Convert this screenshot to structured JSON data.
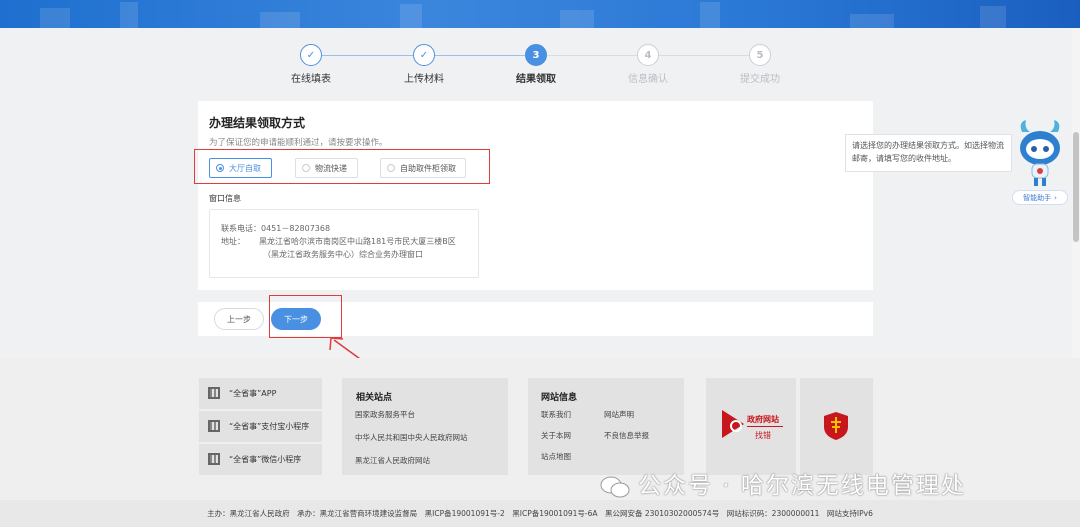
{
  "steps": [
    {
      "num": "✓",
      "label": "在线填表",
      "state": "done"
    },
    {
      "num": "✓",
      "label": "上传材料",
      "state": "done"
    },
    {
      "num": "3",
      "label": "结果领取",
      "state": "active"
    },
    {
      "num": "4",
      "label": "信息确认",
      "state": "todo"
    },
    {
      "num": "5",
      "label": "提交成功",
      "state": "todo"
    }
  ],
  "card": {
    "title": "办理结果领取方式",
    "tip": "为了保证您的申请能顺利通过，请按要求操作。",
    "options": [
      "大厅自取",
      "物流快递",
      "自助取件柜领取"
    ],
    "window_label": "窗口信息",
    "phone_label": "联系电话：",
    "phone": "0451－82807368",
    "addr_label": "地址：",
    "addr_line1": "黑龙江省哈尔滨市南岗区中山路181号市民大厦三楼B区",
    "addr_line2": "（黑龙江省政务服务中心）综合业务办理窗口"
  },
  "actions": {
    "prev": "上一步",
    "next": "下一步"
  },
  "assistant": {
    "tooltip": "请选择您的办理结果领取方式。如选择物流邮寄，请填写您的收件地址。",
    "button": "智能助手"
  },
  "footer": {
    "apps": [
      "“全省事”APP",
      "“全省事”支付宝小程序",
      "“全省事”微信小程序"
    ],
    "related_title": "相关站点",
    "related_links": [
      "国家政务服务平台",
      "中华人民共和国中央人民政府网站",
      "黑龙江省人民政府网站"
    ],
    "info_title": "网站信息",
    "info_links": [
      "联系我们",
      "网站声明",
      "关于本网",
      "不良信息举报",
      "站点地图"
    ],
    "gov_title": "政府网站",
    "gov_sub": "找错",
    "bottom_line": "主办：黑龙江省人民政府　承办：黑龙江省营商环境建设监督局　黑ICP备19001091号-2　黑ICP备19001091号-6A　黑公网安备 23010302000574号　网站标识码：2300000011　网站支持IPv6"
  },
  "watermark": "公众号 · 哈尔滨无线电管理处",
  "colors": {
    "accent": "#4a90e2",
    "highlight": "#e23b3b"
  }
}
